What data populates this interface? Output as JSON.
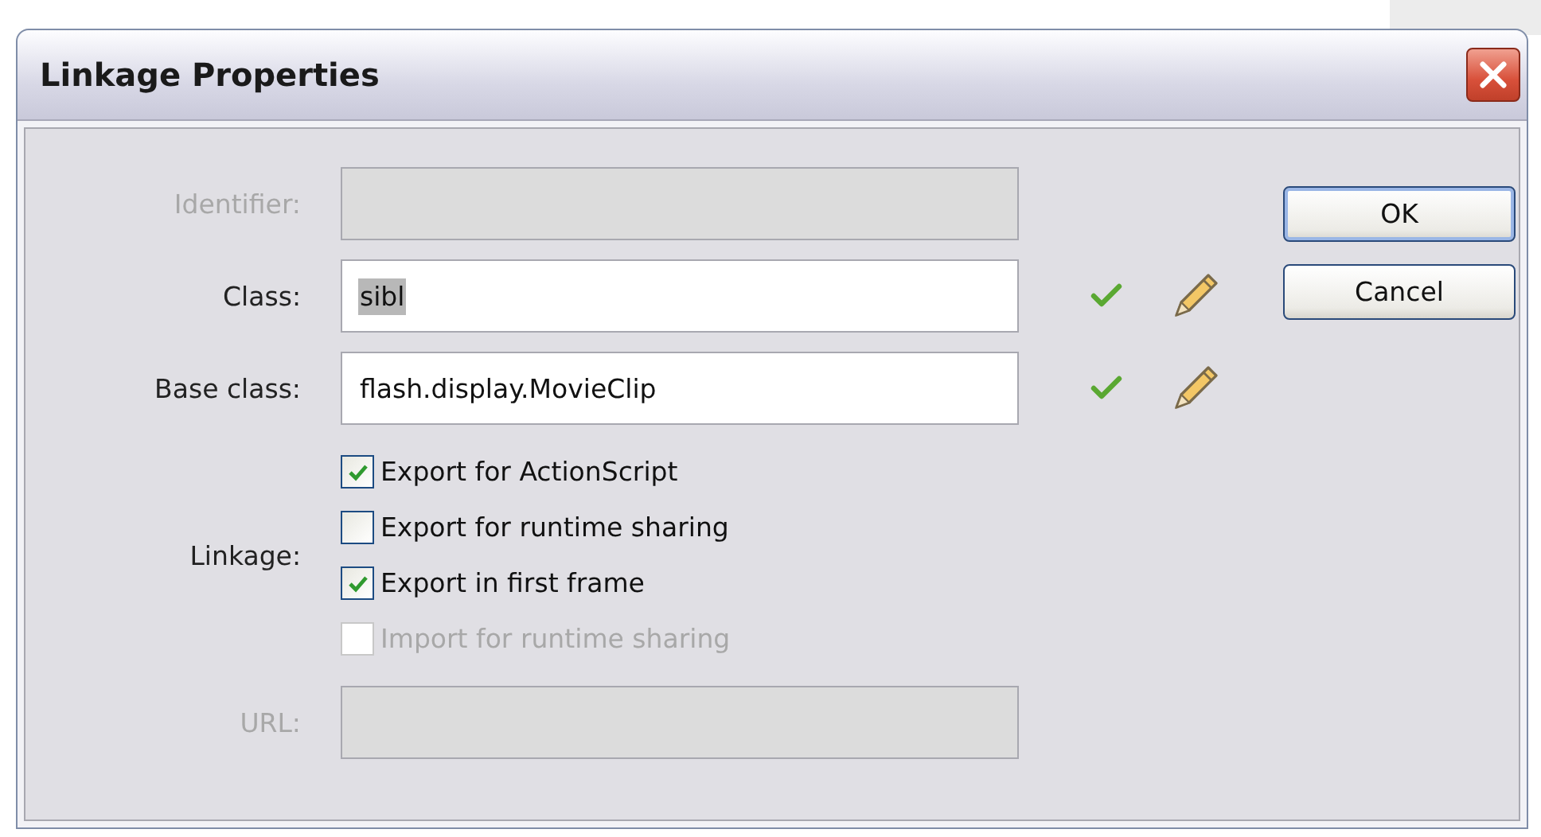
{
  "window": {
    "title": "Linkage Properties"
  },
  "fields": [
    {
      "label": "Identifier:",
      "kind": "plain",
      "disabled": true
    },
    {
      "label": "Class:",
      "kind": "tools",
      "disabled": false,
      "value": "sibl",
      "value_selected": true
    },
    {
      "label": "Base class:",
      "kind": "tools",
      "disabled": false,
      "value": "flash.display.MovieClip",
      "value_selected": false
    }
  ],
  "linkage": {
    "label": "Linkage:",
    "options": [
      {
        "label": "Export for ActionScript",
        "checked": true,
        "disabled": false
      },
      {
        "label": "Export for runtime sharing",
        "checked": false,
        "disabled": false
      },
      {
        "label": "Export in first frame",
        "checked": true,
        "disabled": false
      },
      {
        "label": "Import for runtime sharing",
        "checked": false,
        "disabled": true
      }
    ]
  },
  "url": {
    "label": "URL:",
    "disabled": true
  },
  "buttons": [
    {
      "label": "OK",
      "default": true
    },
    {
      "label": "Cancel",
      "default": false
    }
  ]
}
